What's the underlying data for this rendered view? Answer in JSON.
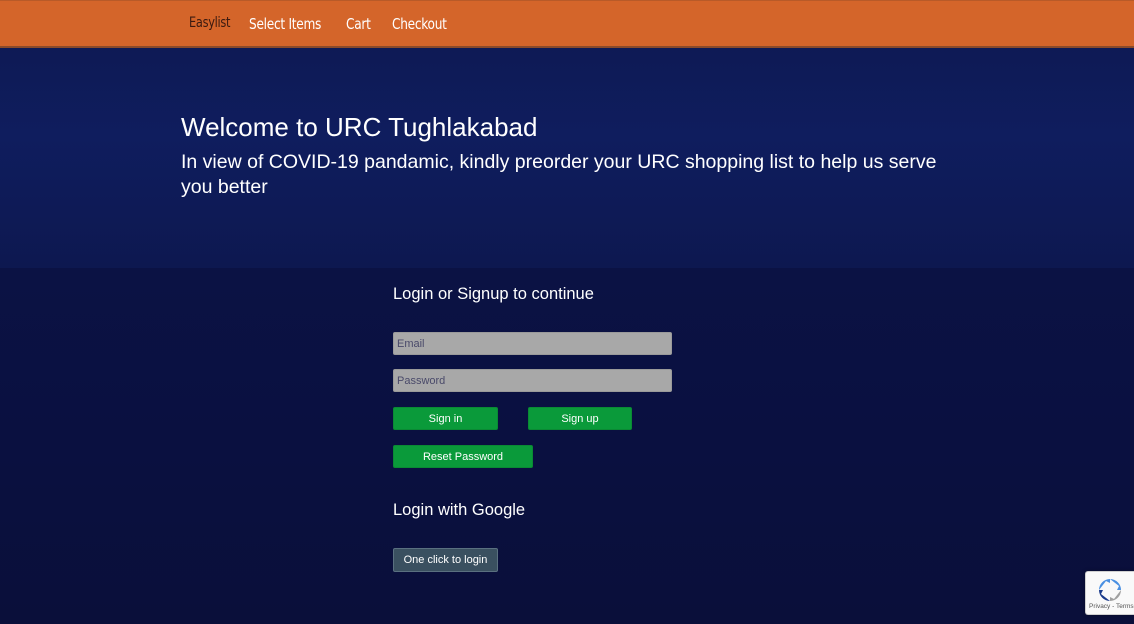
{
  "nav": {
    "brand": "Easylist",
    "items": [
      {
        "label": "Select Items"
      },
      {
        "label": "Cart"
      },
      {
        "label": "Checkout"
      }
    ]
  },
  "hero": {
    "title": "Welcome to URC Tughlakabad",
    "subtitle": "In view of COVID-19 pandamic, kindly preorder your URC shopping list to help us serve you better"
  },
  "login": {
    "heading": "Login or Signup to continue",
    "email_placeholder": "Email",
    "password_placeholder": "Password",
    "signin_label": "Sign in",
    "signup_label": "Sign up",
    "reset_label": "Reset Password"
  },
  "google": {
    "heading": "Login with Google",
    "button_label": "One click to login"
  },
  "recaptcha": {
    "links": "Privacy - Terms",
    "icon": "recaptcha-icon"
  },
  "colors": {
    "navbar": "#d4652a",
    "background": "#0b1140",
    "button_green": "#0a9a3a",
    "google_button": "#3a5060"
  }
}
